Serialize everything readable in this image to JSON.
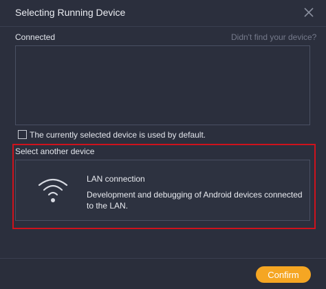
{
  "dialog": {
    "title": "Selecting Running Device",
    "close_icon": "close-icon"
  },
  "connected": {
    "label": "Connected",
    "help_link": "Didn't find your device?"
  },
  "default_option": {
    "checked": false,
    "label": "The currently selected device is used by default."
  },
  "another_device": {
    "label": "Select another device",
    "lan": {
      "icon": "wifi-icon",
      "title": "LAN connection",
      "description": "Development and debugging of Android devices connected to the LAN."
    }
  },
  "footer": {
    "confirm_label": "Confirm"
  },
  "colors": {
    "background": "#2b2f3d",
    "accent": "#f5a623",
    "highlight_border": "#d0121c",
    "muted_text": "#757a8b"
  }
}
